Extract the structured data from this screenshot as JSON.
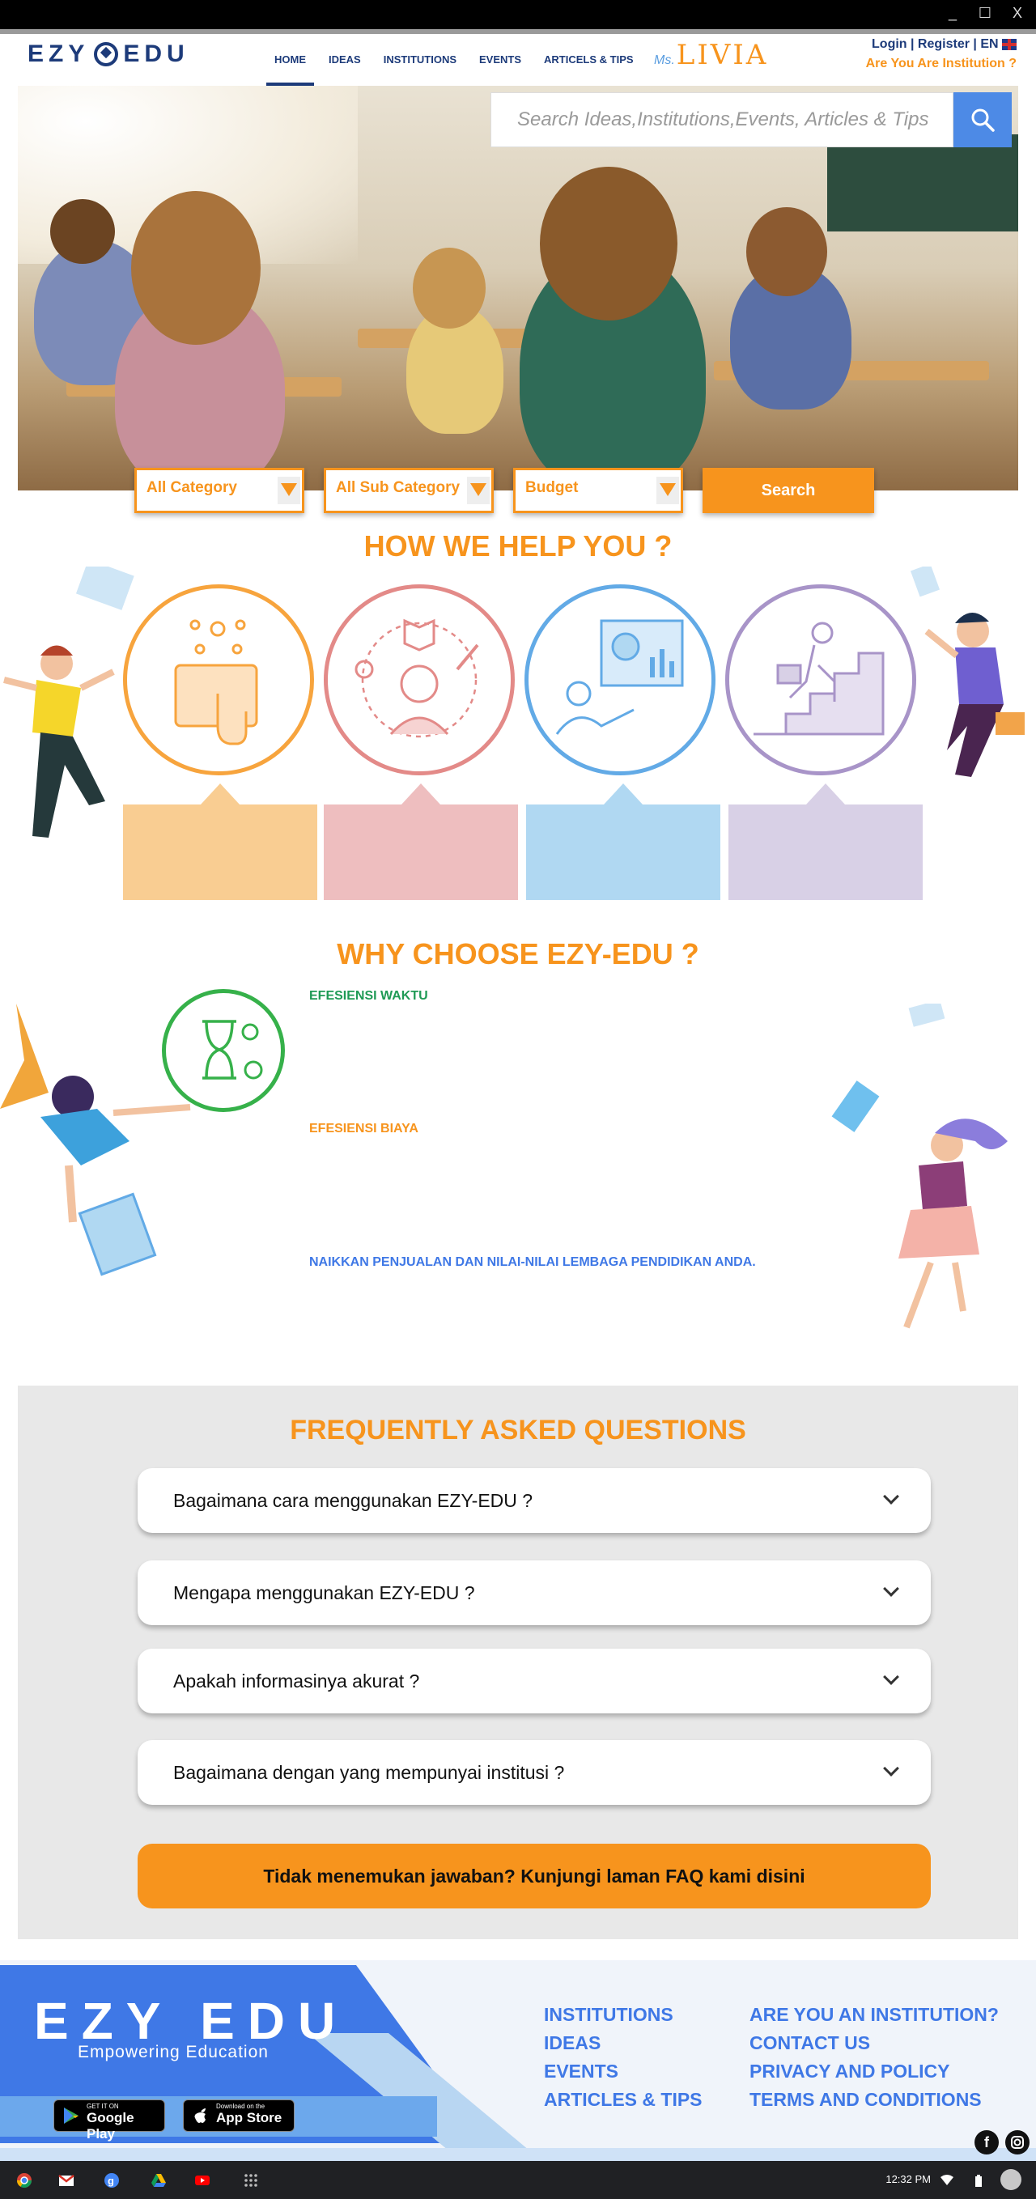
{
  "window": {
    "minimize": "_",
    "maximize": "☐",
    "close": "X"
  },
  "header": {
    "logo_text": "EZY EDU",
    "nav": [
      "HOME",
      "IDEAS",
      "INSTITUTIONS",
      "EVENTS",
      "ARTICELS & TIPS"
    ],
    "livia_prefix": "Ms.",
    "livia_name": "LIVIA",
    "auth": "Login | Register | EN",
    "institution_link": "Are You Are Institution ?"
  },
  "hero": {
    "search_placeholder": "Search Ideas,Institutions,Events, Articles & Tips",
    "filters": [
      "All Category",
      "All Sub Category",
      "Budget"
    ],
    "search_button": "Search"
  },
  "help": {
    "title": "HOW WE HELP YOU ?",
    "colors": [
      "#f7a43d",
      "#e38a88",
      "#62aae6",
      "#a894c8"
    ],
    "box_colors": [
      "#f9cd92",
      "#eebebf",
      "#b0d8f2",
      "#d8d0e6"
    ]
  },
  "why": {
    "title": "WHY CHOOSE EZY-EDU ?",
    "items": [
      {
        "label": "EFESIENSI WAKTU",
        "color": "#1f9a55"
      },
      {
        "label": "EFESIENSI BIAYA",
        "color": "#f7941d"
      },
      {
        "label": "NAIKKAN PENJUALAN DAN NILAI-NILAI  LEMBAGA PENDIDIKAN ANDA.",
        "color": "#3f78e6"
      }
    ]
  },
  "faq": {
    "title": "FREQUENTLY ASKED QUESTIONS",
    "questions": [
      "Bagaimana cara menggunakan EZY-EDU ?",
      "Mengapa menggunakan EZY-EDU ?",
      "Apakah informasinya akurat ?",
      "Bagaimana dengan yang mempunyai institusi ?"
    ],
    "cta": "Tidak menemukan jawaban? Kunjungi laman FAQ kami disini"
  },
  "footer": {
    "brand": "EZY EDU",
    "tagline": "Empowering Education",
    "google_small": "GET IT ON",
    "google_big": "Google Play",
    "apple_small": "Download on the",
    "apple_big": "App Store",
    "links_left": [
      "INSTITUTIONS",
      "IDEAS",
      "EVENTS",
      "ARTICLES & TIPS"
    ],
    "links_right": [
      "ARE YOU AN INSTITUTION?",
      "CONTACT US",
      "PRIVACY AND POLICY",
      "TERMS AND CONDITIONS"
    ]
  },
  "taskbar": {
    "time": "12:32 PM"
  }
}
